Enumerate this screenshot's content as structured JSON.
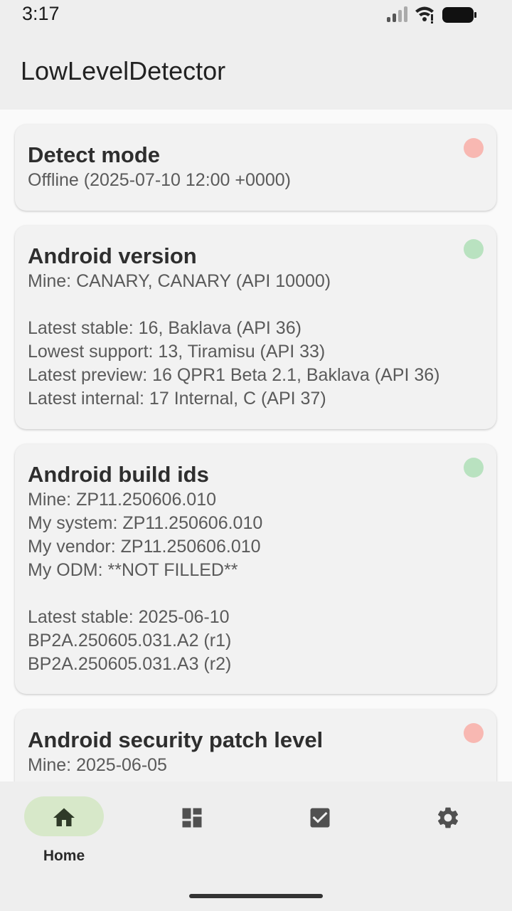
{
  "status_bar": {
    "time": "3:17"
  },
  "app_bar": {
    "title": "LowLevelDetector"
  },
  "cards": [
    {
      "title": "Detect mode",
      "status_color": "#f8b8b2",
      "lines": [
        "Offline (2025-07-10 12:00 +0000)"
      ]
    },
    {
      "title": "Android version",
      "status_color": "#b9e2c0",
      "lines": [
        "Mine: CANARY, CANARY (API 10000)",
        "",
        "Latest stable: 16, Baklava (API 36)",
        "Lowest support: 13, Tiramisu (API 33)",
        "Latest preview: 16 QPR1 Beta 2.1, Baklava  (API 36)",
        "Latest internal: 17 Internal, C (API 37)"
      ]
    },
    {
      "title": "Android build ids",
      "status_color": "#b9e2c0",
      "lines": [
        "Mine: ZP11.250606.010",
        "My system: ZP11.250606.010",
        "My vendor: ZP11.250606.010",
        "My ODM: **NOT FILLED**",
        "",
        "Latest stable: 2025-06-10",
        "BP2A.250605.031.A2 (r1)",
        "BP2A.250605.031.A3 (r2)"
      ]
    },
    {
      "title": "Android security patch level",
      "status_color": "#f8b8b2",
      "lines": [
        "Mine: 2025-06-05"
      ]
    }
  ],
  "bottom_nav": {
    "items": [
      {
        "label": "Home",
        "icon": "home-icon",
        "selected": true
      },
      {
        "label": "",
        "icon": "dashboard-icon",
        "selected": false
      },
      {
        "label": "",
        "icon": "checkbox-icon",
        "selected": false
      },
      {
        "label": "",
        "icon": "settings-gear-icon",
        "selected": false
      }
    ],
    "selected_pill_color": "#d7e8c9"
  },
  "colors": {
    "status_ok": "#b9e2c0",
    "status_bad": "#f8b8b2",
    "card_background": "#f2f2f2",
    "app_bar_background": "#eeeeee"
  }
}
